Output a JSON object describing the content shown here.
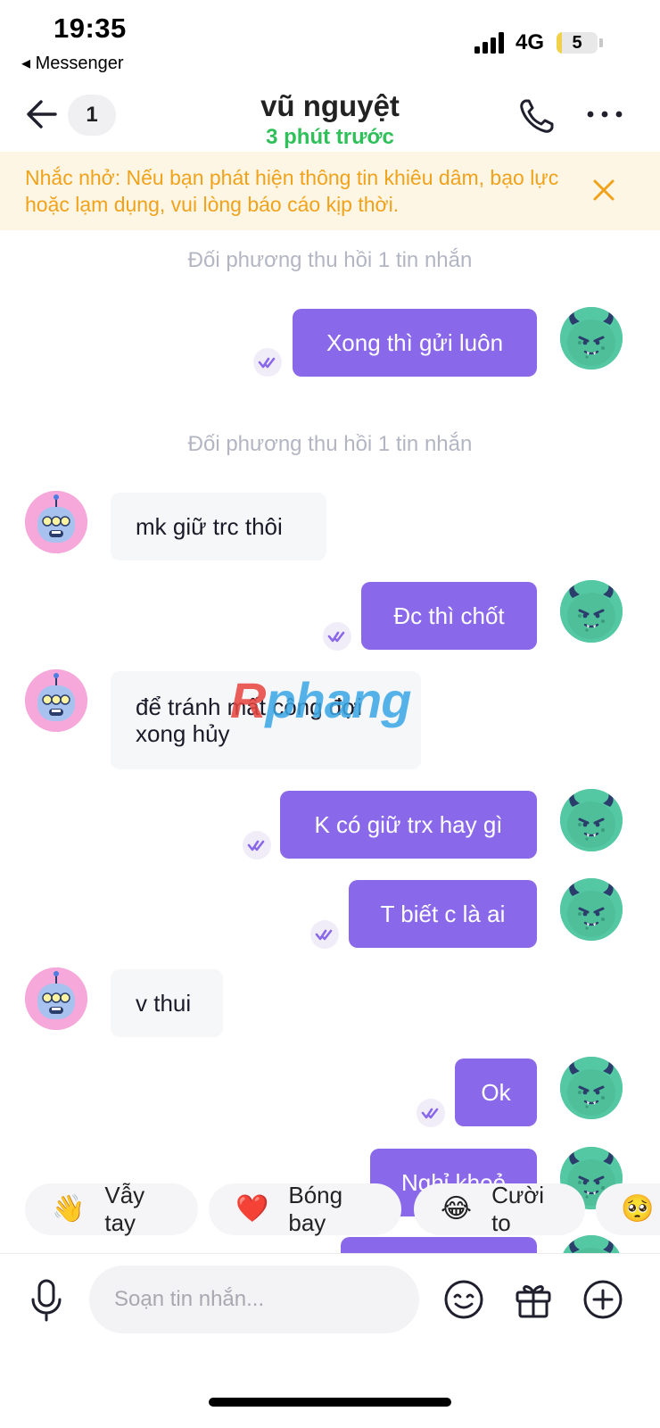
{
  "status_bar": {
    "time": "19:35",
    "back_app": "◂ Messenger",
    "network": "4G",
    "battery": "5",
    "battery_level_percent": 5
  },
  "header": {
    "unread_count": "1",
    "contact_name": "vũ nguyệt",
    "last_seen": "3 phút trước"
  },
  "banner": {
    "text": "Nhắc nhở: Nếu bạn phát hiện thông tin khiêu dâm, bạo lực hoặc lạm dụng, vui lòng báo cáo kịp thời."
  },
  "messages": {
    "system_1": "Đối phương thu hồi 1 tin nhắn",
    "m1": "Xong thì gửi luôn",
    "system_2": "Đối phương thu hồi 1 tin nhắn",
    "m2": "mk giữ trc thôi",
    "m3": "Đc thì chốt",
    "m4_line1": "để tránh mất công đợi",
    "m4_line2": "xong hủy",
    "m5": "K có giữ trx hay gì",
    "m6": "T biết c là ai",
    "m7": "v thui",
    "m8": "Ok",
    "m9": "Nghỉ khoẻ"
  },
  "watermark": {
    "part1": "R",
    "part2": "phang"
  },
  "reactions": [
    {
      "emoji": "👋",
      "label": "Vẫy tay",
      "icon": "wave-icon"
    },
    {
      "emoji": "❤️",
      "label": "Bóng bay",
      "icon": "heart-icon"
    },
    {
      "emoji": "😂",
      "label": "Cười to",
      "icon": "laugh-icon"
    },
    {
      "emoji": "🥺",
      "label": "",
      "icon": "pleading-face-icon"
    }
  ],
  "composer": {
    "placeholder": "Soạn tin nhắn..."
  },
  "colors": {
    "accent": "#8a68ea",
    "online_green": "#2fc05a",
    "banner_text": "#f0a21b",
    "banner_bg": "#fdf6e4"
  }
}
